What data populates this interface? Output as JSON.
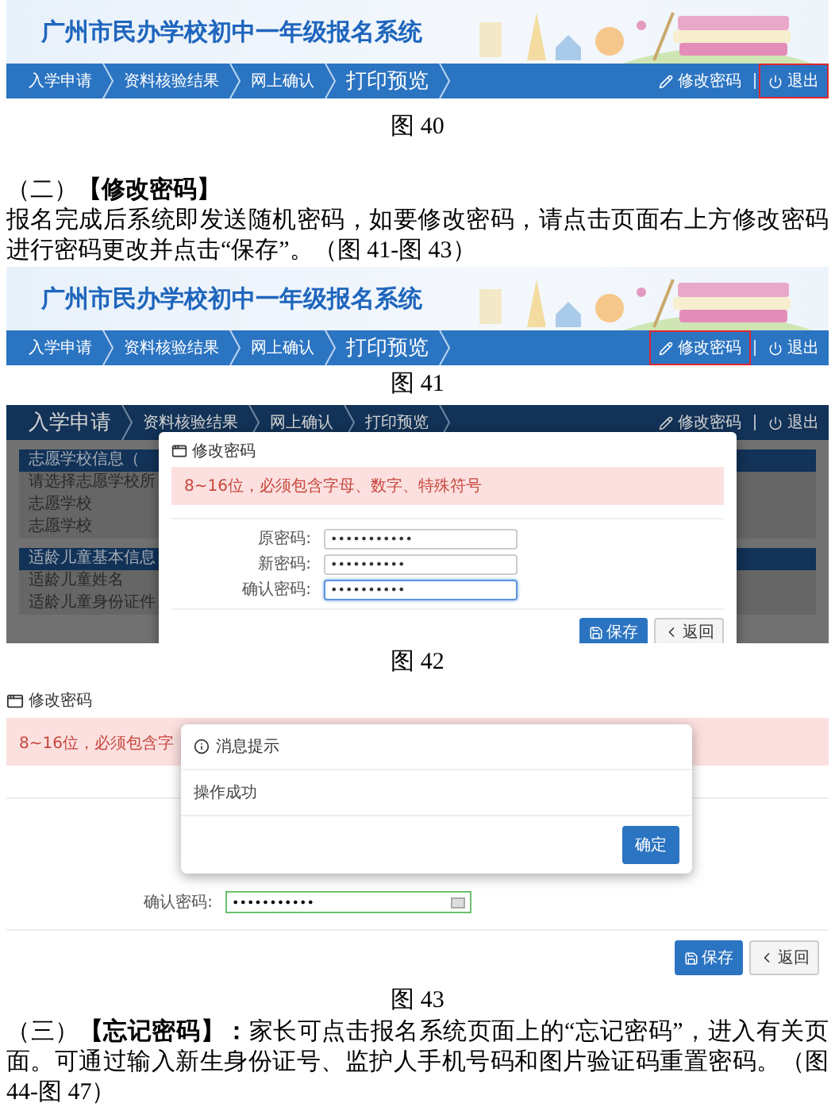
{
  "fig40": {
    "title": "广州市民办学校初中一年级报名系统",
    "nav": [
      {
        "label": "入学申请",
        "selected": false
      },
      {
        "label": "资料核验结果",
        "selected": false
      },
      {
        "label": "网上确认",
        "selected": false
      },
      {
        "label": "打印预览",
        "selected": true
      }
    ],
    "actions": [
      {
        "kind": "edit",
        "label": "修改密码",
        "highlighted": false
      },
      {
        "kind": "logout",
        "label": "退出",
        "highlighted": true
      }
    ],
    "caption": "图 40"
  },
  "section_2": {
    "heading": "（二）**【修改密码】**",
    "text": "报名完成后系统即发送随机密码，如要修改密码，请点击页面右上方修改密码进行密码更改并点击“保存”。（图 41-图 43）"
  },
  "fig41": {
    "title": "广州市民办学校初中一年级报名系统",
    "nav": [
      {
        "label": "入学申请",
        "selected": false
      },
      {
        "label": "资料核验结果",
        "selected": false
      },
      {
        "label": "网上确认",
        "selected": false
      },
      {
        "label": "打印预览",
        "selected": true
      }
    ],
    "actions": [
      {
        "kind": "edit",
        "label": "修改密码",
        "highlighted": true
      },
      {
        "kind": "logout",
        "label": "退出",
        "highlighted": false
      }
    ],
    "caption": "图 41"
  },
  "fig42": {
    "nav": [
      {
        "label": "入学申请",
        "selected": true
      },
      {
        "label": "资料核验结果",
        "selected": false
      },
      {
        "label": "网上确认",
        "selected": false
      },
      {
        "label": "打印预览",
        "selected": false
      }
    ],
    "actions": [
      {
        "kind": "edit",
        "label": "修改密码",
        "highlighted": false
      },
      {
        "kind": "logout",
        "label": "退出",
        "highlighted": false
      }
    ],
    "panels": [
      {
        "title": "志愿学校信息（",
        "rows": [
          "请选择志愿学校所",
          "志愿学校",
          "志愿学校"
        ]
      },
      {
        "title": "适龄儿童基本信息",
        "rows": [
          "适龄儿童姓名",
          "适龄儿童身份证件"
        ]
      }
    ],
    "dialog": {
      "title": "修改密码",
      "alert": "8~16位，必须包含字母、数字、特殊符号",
      "fields": [
        {
          "label": "原密码:",
          "value": "•••••••••••",
          "focused": false
        },
        {
          "label": "新密码:",
          "value": "••••••••••",
          "focused": false
        },
        {
          "label": "确认密码:",
          "value": "••••••••••",
          "focused": true
        }
      ],
      "buttons": [
        {
          "kind": "save",
          "label": "保存"
        },
        {
          "kind": "back",
          "label": "返回"
        }
      ]
    },
    "caption": "图 42"
  },
  "fig43": {
    "title": "修改密码",
    "alert": "8~16位，必须包含字",
    "field": {
      "label": "确认密码:",
      "value": "•••••••••••"
    },
    "buttons": [
      {
        "kind": "save",
        "label": "保存"
      },
      {
        "kind": "back",
        "label": "返回"
      }
    ],
    "message": {
      "title": "消息提示",
      "text": "操作成功",
      "button": "确定"
    },
    "caption": "图 43"
  },
  "section_3": {
    "text": "（三）**【忘记密码】：**家长可点击报名系统页面上的“忘记密码”，进入有关页面。可通过输入新生身份证号、监护人手机号码和图片验证码重置密码。（图 44-图 47）"
  }
}
